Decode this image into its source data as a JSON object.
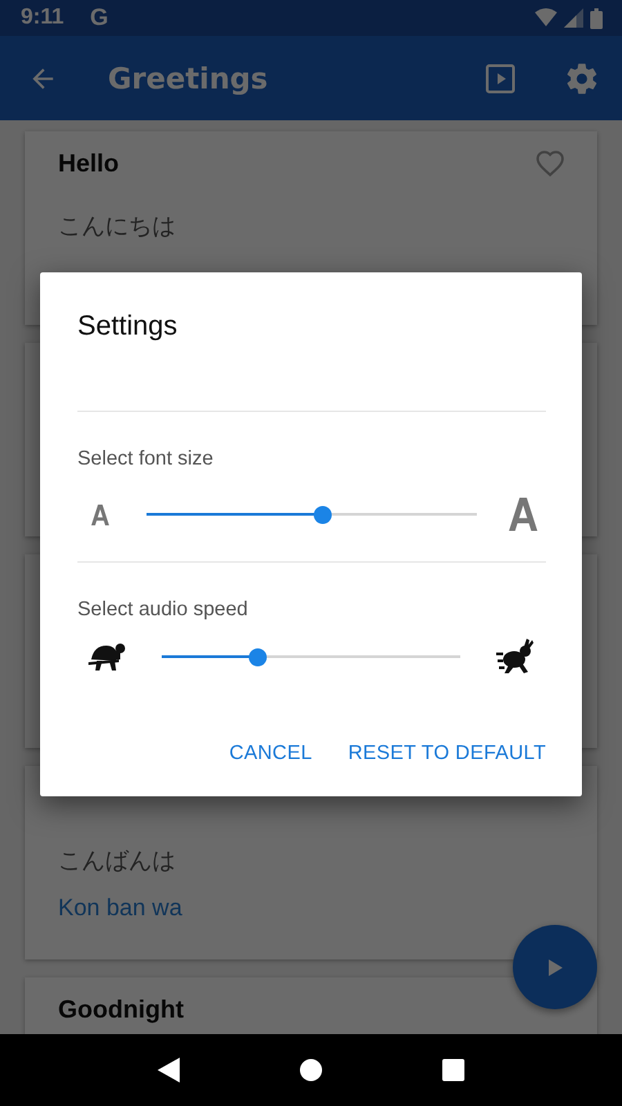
{
  "status_bar": {
    "time": "9:11",
    "notification": "G"
  },
  "app_bar": {
    "title": "Greetings"
  },
  "cards": [
    {
      "kind": "phrase",
      "title": "Hello",
      "japanese": "こんにちは",
      "favorite": false
    },
    {
      "kind": "covered"
    },
    {
      "kind": "covered"
    },
    {
      "kind": "phrase",
      "japanese": "こんばんは",
      "romaji": "Kon ban wa"
    },
    {
      "kind": "phrase",
      "title": "Goodnight"
    }
  ],
  "dialog": {
    "title": "Settings",
    "sliders": [
      {
        "label": "Select font size",
        "kind": "font",
        "level": 0.53
      },
      {
        "label": "Select audio speed",
        "kind": "speed",
        "level": 0.32
      }
    ],
    "buttons": [
      "CANCEL",
      "RESET TO DEFAULT"
    ]
  }
}
